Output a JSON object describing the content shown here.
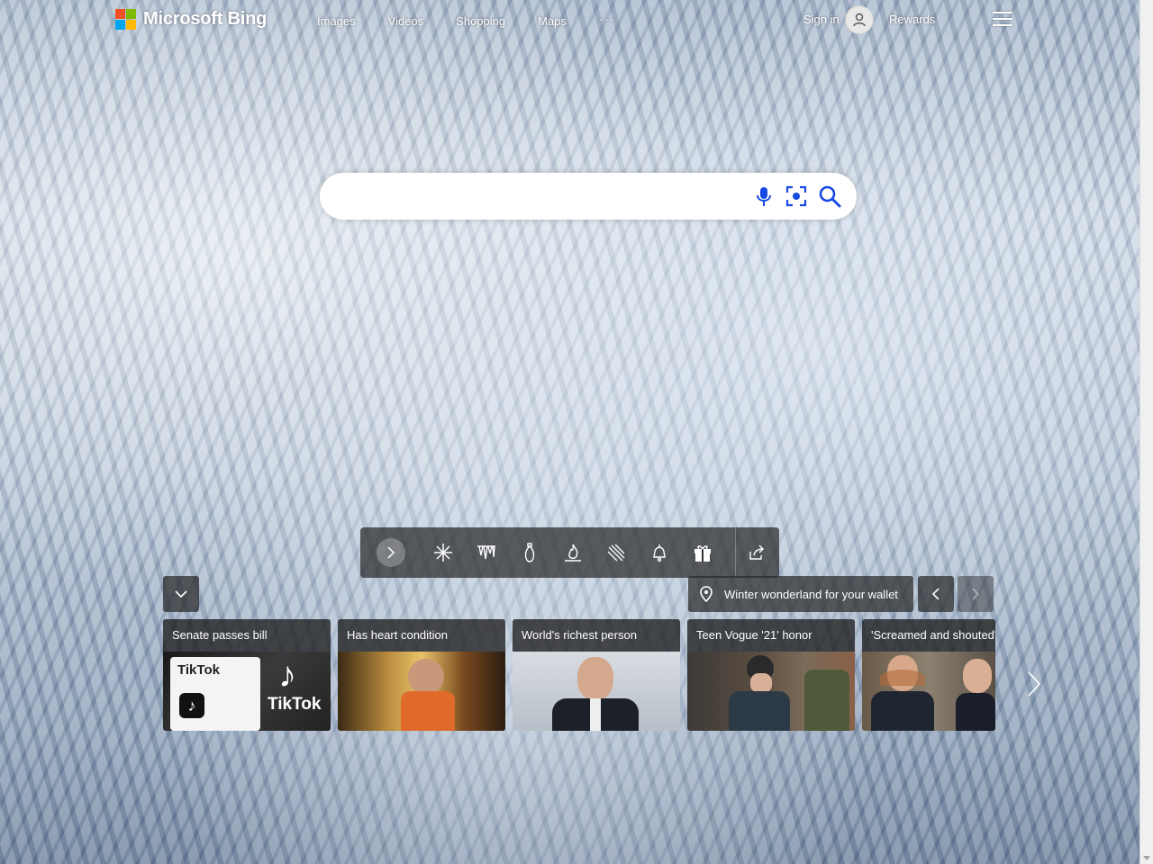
{
  "brand": {
    "name": "Microsoft Bing",
    "colors": {
      "red": "#f25022",
      "green": "#7fba00",
      "blue": "#00a4ef",
      "yellow": "#ffb900"
    }
  },
  "nav": {
    "items": [
      "Images",
      "Videos",
      "Shopping",
      "Maps"
    ],
    "more": "···"
  },
  "account": {
    "signin": "Sign in",
    "rewards": "Rewards"
  },
  "search": {
    "value": "",
    "placeholder": ""
  },
  "toolbar": {
    "icons": [
      "chevron-right-icon",
      "snowflake-icon",
      "icicles-icon",
      "ornament-icon",
      "fire-icon",
      "snowy-tree-icon",
      "bell-icon",
      "gift-icon",
      "share-icon"
    ]
  },
  "location": {
    "text": "Winter wonderland for your wallet"
  },
  "news": [
    {
      "title": "Senate passes bill"
    },
    {
      "title": "Has heart condition"
    },
    {
      "title": "World's richest person"
    },
    {
      "title": "Teen Vogue '21' honor"
    },
    {
      "title": "'Screamed and shouted'"
    }
  ],
  "tiktok_card": {
    "label": "TikTok"
  }
}
